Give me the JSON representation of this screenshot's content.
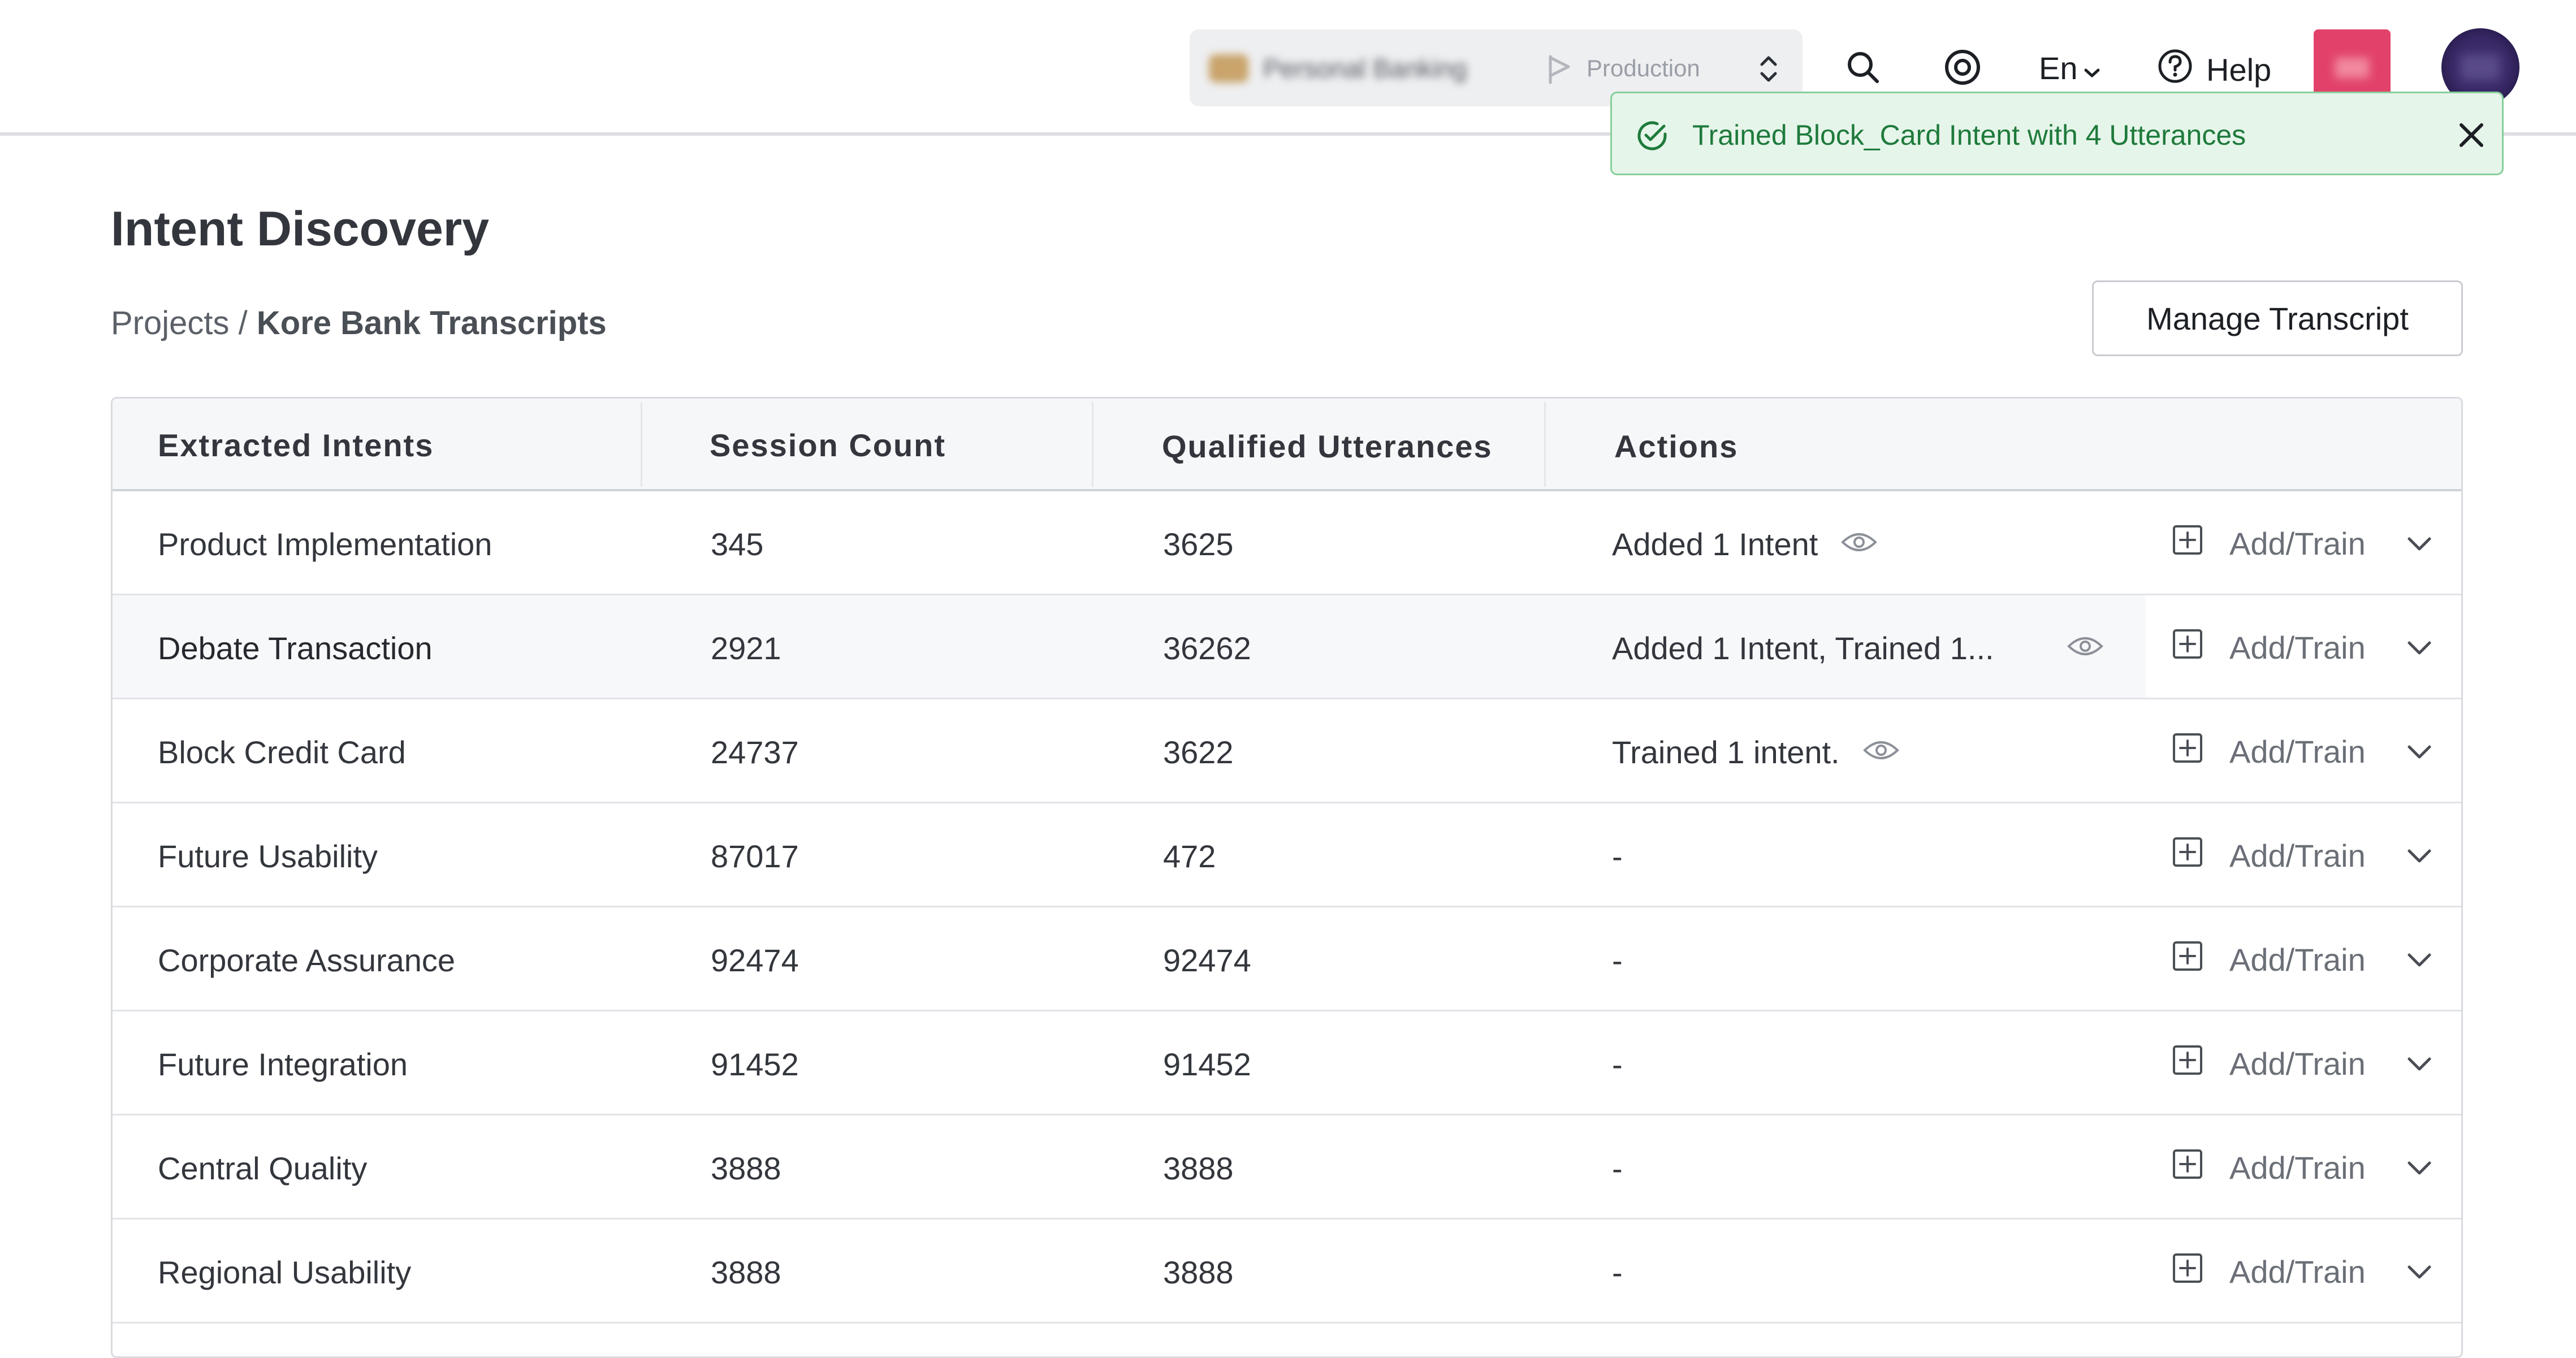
{
  "topbar": {
    "env_switcher": {
      "app_name": "Personal Banking",
      "environment": "Production"
    },
    "language": "En",
    "help_label": "Help"
  },
  "toast": {
    "message": "Trained Block_Card Intent with 4 Utterances"
  },
  "page": {
    "title": "Intent Discovery",
    "breadcrumb": {
      "parent": "Projects",
      "separator": "/",
      "current": "Kore Bank Transcripts"
    },
    "manage_button": "Manage Transcript"
  },
  "table": {
    "headers": [
      "Extracted Intents",
      "Session Count",
      "Qualified Utterances",
      "Actions"
    ],
    "add_train_label": "Add/Train",
    "rows": [
      {
        "intent": "Product Implementation",
        "sessions": "345",
        "utterances": "3625",
        "action": "Added 1 Intent",
        "has_eye": true
      },
      {
        "intent": "Debate Transaction",
        "sessions": "2921",
        "utterances": "36262",
        "action": "Added 1 Intent, Trained 1...",
        "has_eye": true
      },
      {
        "intent": "Block Credit Card",
        "sessions": "24737",
        "utterances": "3622",
        "action": "Trained 1 intent.",
        "has_eye": true
      },
      {
        "intent": "Future Usability",
        "sessions": "87017",
        "utterances": "472",
        "action": "-",
        "has_eye": false
      },
      {
        "intent": "Corporate Assurance",
        "sessions": "92474",
        "utterances": "92474",
        "action": "-",
        "has_eye": false
      },
      {
        "intent": "Future Integration",
        "sessions": "91452",
        "utterances": "91452",
        "action": "-",
        "has_eye": false
      },
      {
        "intent": "Central Quality",
        "sessions": "3888",
        "utterances": "3888",
        "action": "-",
        "has_eye": false
      },
      {
        "intent": "Regional Usability",
        "sessions": "3888",
        "utterances": "3888",
        "action": "-",
        "has_eye": false
      }
    ]
  },
  "colors": {
    "toast_bg": "#e6f5ea",
    "toast_border": "#86cf9a",
    "toast_text": "#1e7a3b",
    "badge_red": "#e2426a",
    "avatar": "#3c2b6a"
  }
}
